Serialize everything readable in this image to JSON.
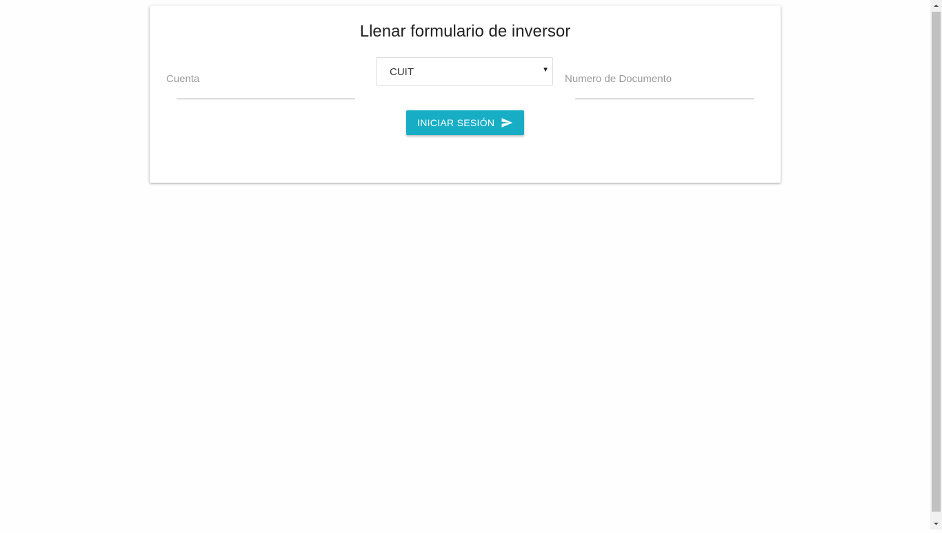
{
  "form": {
    "title": "Llenar formulario de inversor",
    "cuenta_label": "Cuenta",
    "cuenta_value": "",
    "doc_type_selected": "CUIT",
    "doc_number_label": "Numero de Documento",
    "doc_number_value": "",
    "submit_label": "INICIAR SESIÓN",
    "submit_icon": "send-icon"
  },
  "colors": {
    "accent": "#17aec5",
    "background": "#fefefe",
    "card": "#ffffff"
  }
}
